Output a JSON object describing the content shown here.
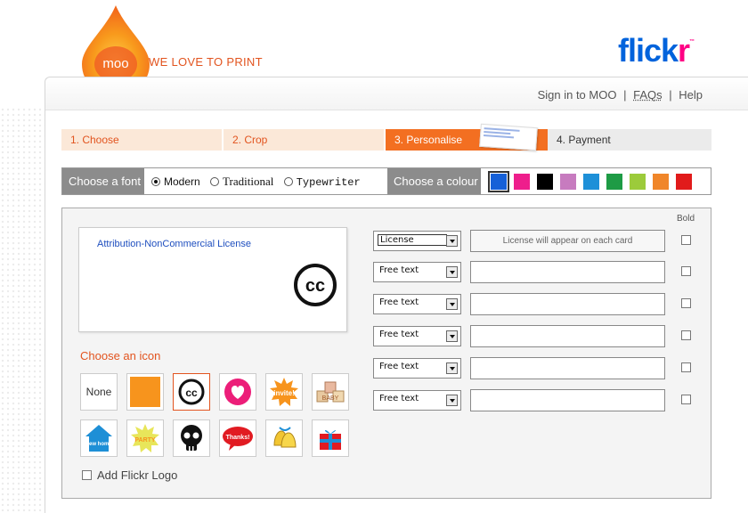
{
  "header": {
    "moo_logo_text": "moo",
    "tagline": "WE LOVE TO PRINT",
    "flickr_logo": "flickr",
    "flickr_tm": "™"
  },
  "toplinks": {
    "sign_in": "Sign in to MOO",
    "sep1": "|",
    "faqs": "FAQs",
    "sep2": "|",
    "help": "Help"
  },
  "steps": [
    {
      "label": "1. Choose",
      "state": "done"
    },
    {
      "label": "2. Crop",
      "state": "done"
    },
    {
      "label": "3. Personalise",
      "state": "active"
    },
    {
      "label": "4. Payment",
      "state": "todo"
    }
  ],
  "options": {
    "font_label": "Choose a font",
    "fonts": [
      {
        "label": "Modern",
        "selected": true
      },
      {
        "label": "Traditional",
        "selected": false
      },
      {
        "label": "Typewriter",
        "selected": false
      }
    ],
    "colour_label": "Choose a colour",
    "colours": [
      "#1560d8",
      "#ee1e8c",
      "#000000",
      "#c77bbf",
      "#1e90d8",
      "#1e9b45",
      "#9ccb3b",
      "#f0862a",
      "#e11b1b"
    ],
    "selected_colour": "#1560d8"
  },
  "card": {
    "line1": "Attribution-NonCommercial License",
    "cc_glyph": "cc"
  },
  "icons": {
    "title": "Choose an icon",
    "none_label": "None",
    "invite_text": "invite!",
    "baby_text": "BABY",
    "party_text": "PARTY",
    "thanks_text": "Thanks!",
    "newhome_text": "new home",
    "selected": "cc-icon-option"
  },
  "add_flickr_logo": "Add Flickr Logo",
  "lines": {
    "bold_label": "Bold",
    "rows": [
      {
        "type": "License",
        "value": "",
        "placeholder": "License will appear on each card"
      },
      {
        "type": "Free text",
        "value": "",
        "placeholder": ""
      },
      {
        "type": "Free text",
        "value": "",
        "placeholder": ""
      },
      {
        "type": "Free text",
        "value": "",
        "placeholder": ""
      },
      {
        "type": "Free text",
        "value": "",
        "placeholder": ""
      },
      {
        "type": "Free text",
        "value": "",
        "placeholder": ""
      }
    ]
  }
}
